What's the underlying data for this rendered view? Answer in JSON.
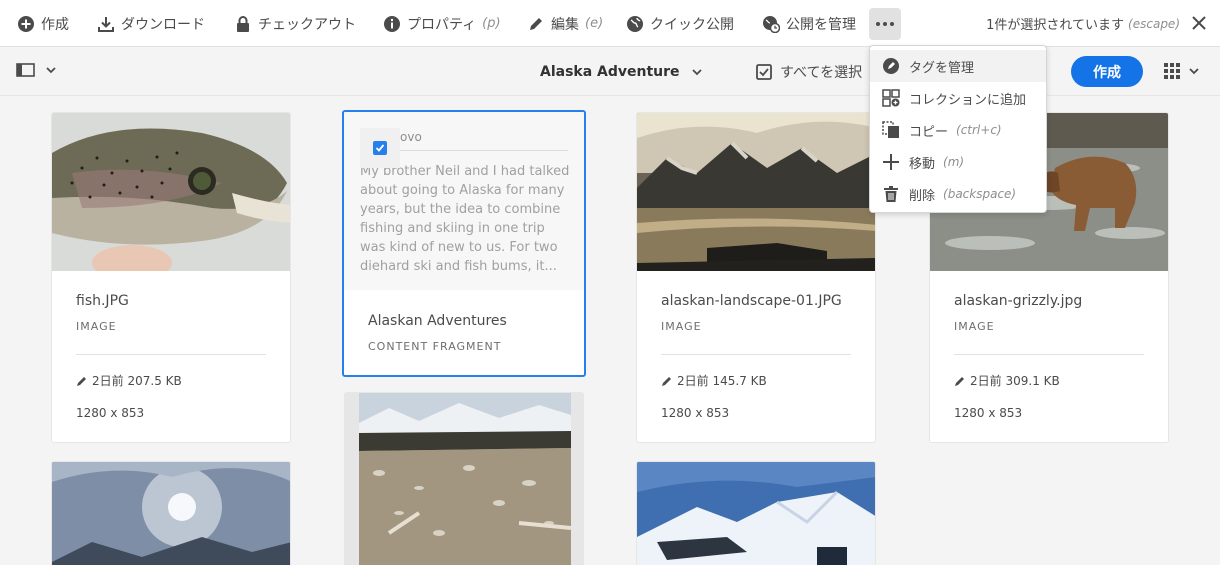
{
  "actionbar": {
    "create": "作成",
    "download": "ダウンロード",
    "checkout": "チェックアウト",
    "properties": "プロパティ",
    "properties_key": "(p)",
    "edit": "編集",
    "edit_key": "(e)",
    "quick_publish": "クイック公開",
    "manage_publication": "公開を管理",
    "selection_count": "1件が選択されています",
    "selection_key": "(escape)"
  },
  "toolbar": {
    "folder_title": "Alaska Adventure",
    "select_all": "すべてを選択",
    "create_button": "作成"
  },
  "popover": {
    "items": [
      {
        "label": "タグを管理",
        "key": ""
      },
      {
        "label": "コレクションに追加",
        "key": ""
      },
      {
        "label": "コピー",
        "key": "(ctrl+c)"
      },
      {
        "label": "移動",
        "key": "(m)"
      },
      {
        "label": "削除",
        "key": "(backspace)"
      }
    ]
  },
  "cards": [
    {
      "title": "fish.JPG",
      "type": "IMAGE",
      "modified": "2日前",
      "size": "207.5 KB",
      "dims": "1280 x 853"
    },
    {
      "title": "Alaskan Adventures",
      "type": "CONTENT FRAGMENT",
      "preview_head": "ovo",
      "preview_body": "My brother Neil and I had talked about going to Alaska for many years, but the idea to combine fishing and skiing in one trip was kind of new to us. For two diehard ski and fish bums, it..."
    },
    {
      "title": "alaskan-landscape-01.JPG",
      "type": "IMAGE",
      "modified": "2日前",
      "size": "145.7 KB",
      "dims": "1280 x 853"
    },
    {
      "title": "alaskan-grizzly.jpg",
      "type": "IMAGE",
      "modified": "2日前",
      "size": "309.1 KB",
      "dims": "1280 x 853"
    }
  ],
  "colors": {
    "accent": "#1473e6",
    "selection_border": "#2680eb"
  }
}
